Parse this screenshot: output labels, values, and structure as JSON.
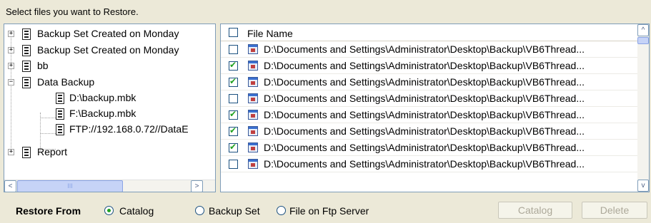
{
  "instruction": "Select files you want to Restore.",
  "tree": {
    "items": [
      {
        "label": "Backup Set Created on Monday",
        "expander": "+"
      },
      {
        "label": "Backup Set Created on Monday",
        "expander": "+"
      },
      {
        "label": "bb",
        "expander": "+"
      },
      {
        "label": "Data Backup",
        "expander": "−"
      },
      {
        "label": "D:\\backup.mbk"
      },
      {
        "label": "F:\\Backup.mbk"
      },
      {
        "label": "FTP://192.168.0.72//DataE"
      },
      {
        "label": "Report",
        "expander": "+"
      }
    ],
    "scroll_left": "<",
    "scroll_right": ">",
    "scroll_thumb": "III"
  },
  "file_list": {
    "header": "File Name",
    "header_checked": false,
    "rows": [
      {
        "name": "D:\\Documents and Settings\\Administrator\\Desktop\\Backup\\VB6Thread...",
        "checked": false
      },
      {
        "name": "D:\\Documents and Settings\\Administrator\\Desktop\\Backup\\VB6Thread...",
        "checked": true
      },
      {
        "name": "D:\\Documents and Settings\\Administrator\\Desktop\\Backup\\VB6Thread...",
        "checked": true
      },
      {
        "name": "D:\\Documents and Settings\\Administrator\\Desktop\\Backup\\VB6Thread...",
        "checked": false
      },
      {
        "name": "D:\\Documents and Settings\\Administrator\\Desktop\\Backup\\VB6Thread...",
        "checked": true
      },
      {
        "name": "D:\\Documents and Settings\\Administrator\\Desktop\\Backup\\VB6Thread...",
        "checked": true
      },
      {
        "name": "D:\\Documents and Settings\\Administrator\\Desktop\\Backup\\VB6Thread...",
        "checked": true
      },
      {
        "name": "D:\\Documents and Settings\\Administrator\\Desktop\\Backup\\VB6Thread...",
        "checked": false
      }
    ],
    "scroll_up": "^",
    "scroll_down": "v"
  },
  "restore": {
    "label": "Restore From",
    "options": [
      {
        "label": "Catalog",
        "selected": true
      },
      {
        "label": "Backup Set",
        "selected": false
      },
      {
        "label": "File on Ftp Server",
        "selected": false
      }
    ],
    "catalog_button": "Catalog",
    "delete_button": "Delete"
  },
  "colors": {
    "background": "#ece9d8",
    "check_green": "#21a121",
    "border": "#7f9db9"
  }
}
